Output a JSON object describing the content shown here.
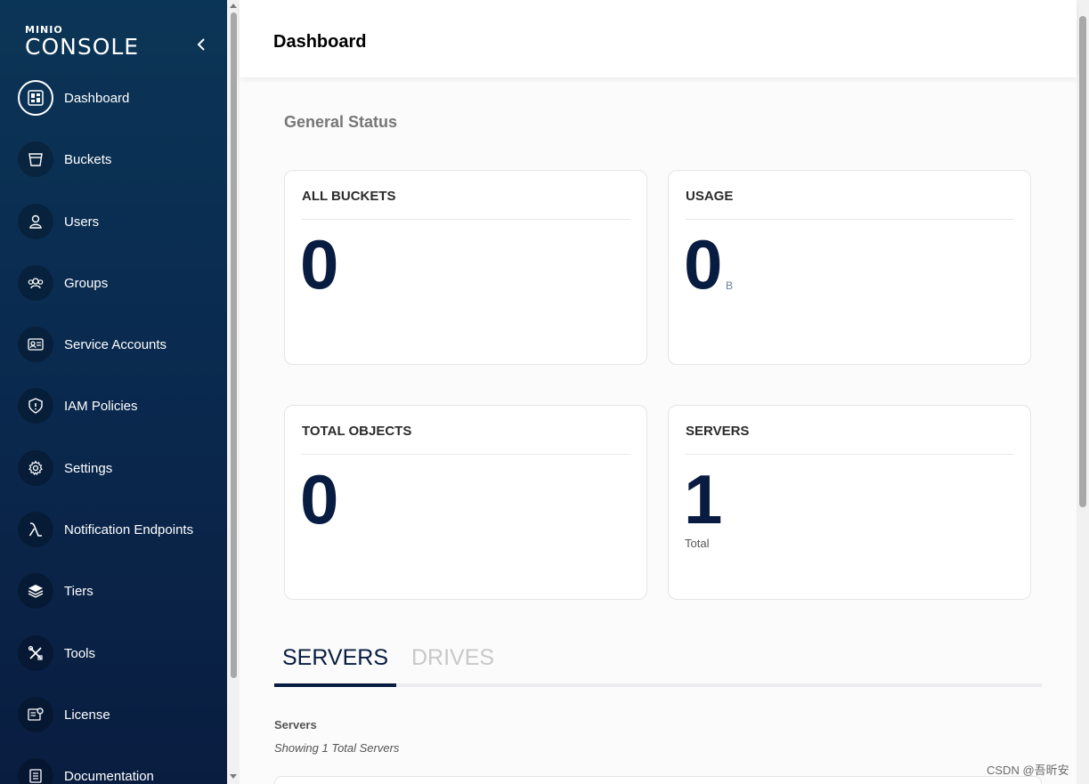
{
  "app": {
    "logo_small": "MINIO",
    "logo_big": "CONSOLE"
  },
  "sidebar": {
    "items": [
      {
        "label": "Dashboard",
        "icon": "dashboard-icon",
        "active": true
      },
      {
        "label": "Buckets",
        "icon": "bucket-icon"
      },
      {
        "label": "Users",
        "icon": "user-icon"
      },
      {
        "label": "Groups",
        "icon": "groups-icon"
      },
      {
        "label": "Service Accounts",
        "icon": "id-card-icon"
      },
      {
        "label": "IAM Policies",
        "icon": "shield-icon"
      },
      {
        "label": "Settings",
        "icon": "gear-icon"
      },
      {
        "label": "Notification Endpoints",
        "icon": "lambda-icon"
      },
      {
        "label": "Tiers",
        "icon": "layers-icon"
      },
      {
        "label": "Tools",
        "icon": "tools-icon"
      },
      {
        "label": "License",
        "icon": "license-icon"
      },
      {
        "label": "Documentation",
        "icon": "document-icon"
      }
    ]
  },
  "header": {
    "title": "Dashboard"
  },
  "general_status": {
    "title": "General Status",
    "cards": [
      {
        "label": "ALL BUCKETS",
        "value": "0",
        "unit": "",
        "sub": ""
      },
      {
        "label": "USAGE",
        "value": "0",
        "unit": "B",
        "sub": ""
      },
      {
        "label": "TOTAL OBJECTS",
        "value": "0",
        "unit": "",
        "sub": ""
      },
      {
        "label": "SERVERS",
        "value": "1",
        "unit": "",
        "sub": "Total"
      }
    ]
  },
  "tabs": [
    {
      "label": "SERVERS",
      "active": true
    },
    {
      "label": "DRIVES",
      "active": false
    }
  ],
  "servers_section": {
    "label": "Servers",
    "count_text": "Showing 1 Total Servers"
  },
  "watermark": "CSDN @吾昕安",
  "colors": {
    "sidebar_top": "#0b3556",
    "sidebar_bottom": "#091d40",
    "accent": "#081c42",
    "muted_text": "#767676"
  }
}
